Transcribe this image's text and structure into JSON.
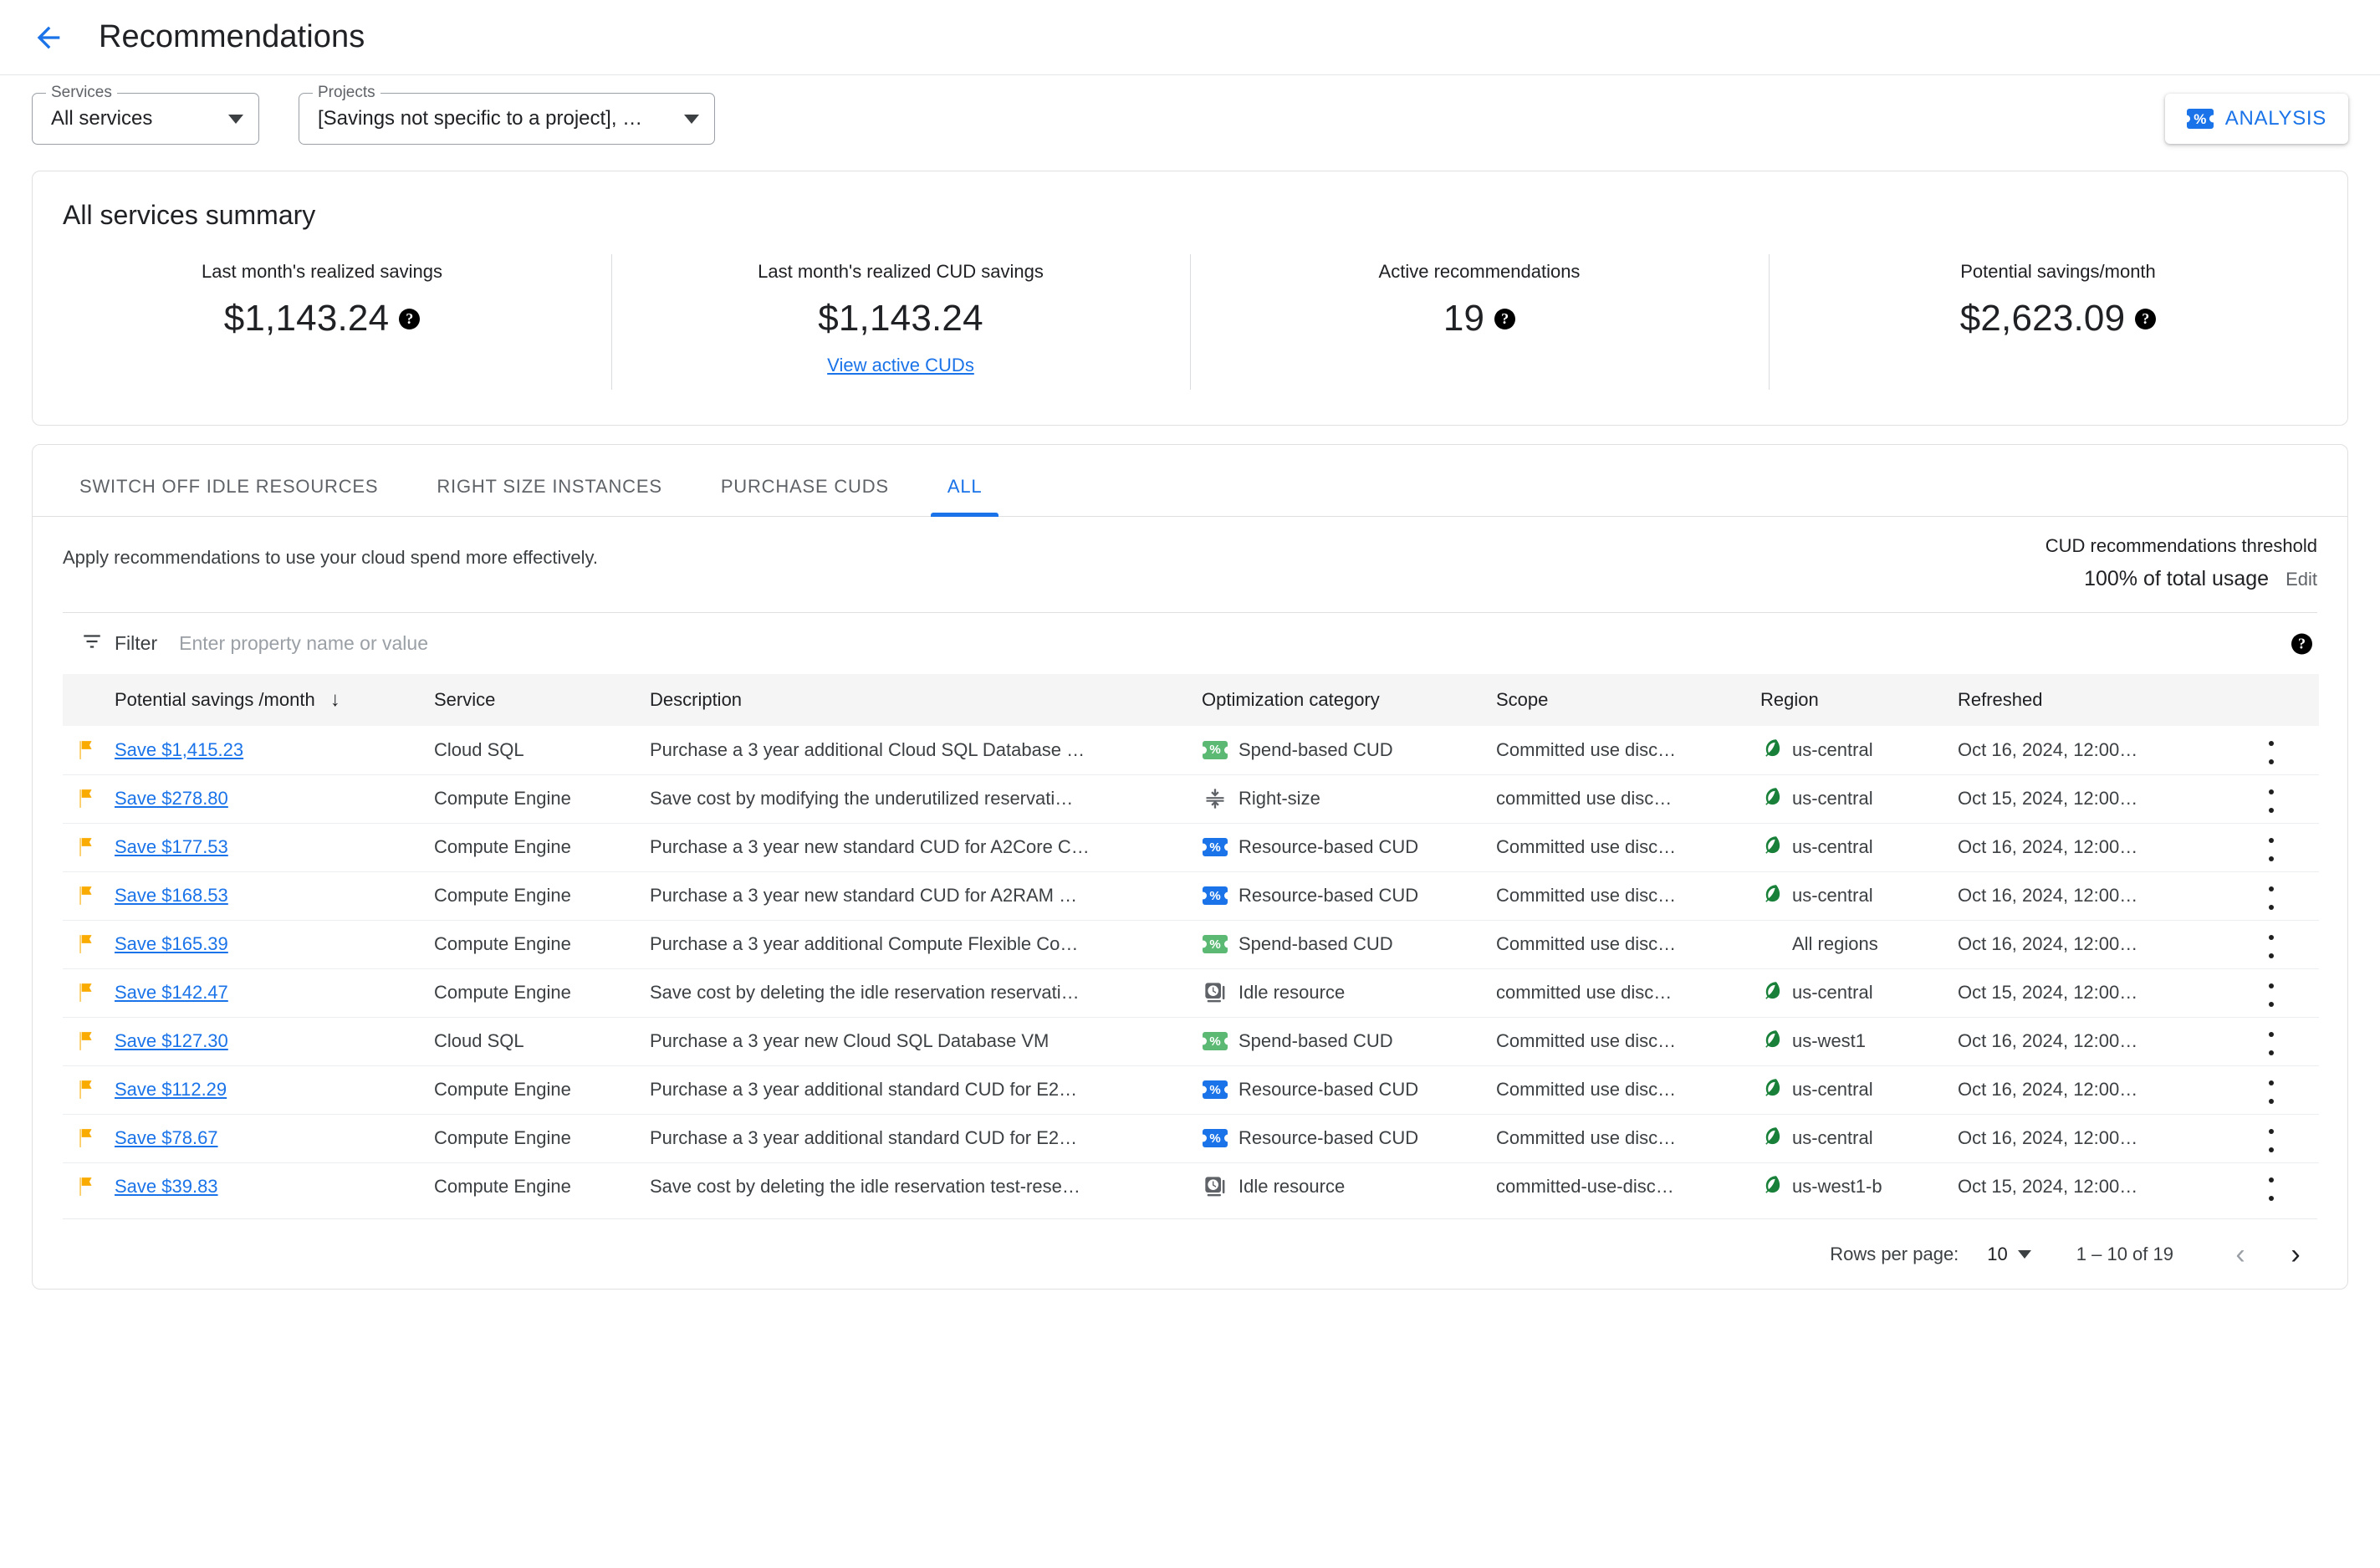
{
  "appbar": {
    "back_icon": "arrow-left-icon",
    "title": "Recommendations"
  },
  "filters": {
    "services": {
      "legend": "Services",
      "value": "All services"
    },
    "projects": {
      "legend": "Projects",
      "value": "[Savings not specific to a project], …"
    },
    "analysis_button": {
      "label": "ANALYSIS",
      "icon": "ticket-percent-icon",
      "color": "#1a73e8"
    }
  },
  "summary": {
    "title": "All services summary",
    "metrics": [
      {
        "label": "Last month's realized savings",
        "value": "$1,143.24",
        "help": true,
        "link": null
      },
      {
        "label": "Last month's realized CUD savings",
        "value": "$1,143.24",
        "help": false,
        "link": "View active CUDs"
      },
      {
        "label": "Active recommendations",
        "value": "19",
        "help": true,
        "link": null
      },
      {
        "label": "Potential savings/month",
        "value": "$2,623.09",
        "help": true,
        "link": null
      }
    ]
  },
  "tabs": [
    {
      "label": "SWITCH OFF IDLE RESOURCES",
      "active": false
    },
    {
      "label": "RIGHT SIZE INSTANCES",
      "active": false
    },
    {
      "label": "PURCHASE CUDS",
      "active": false
    },
    {
      "label": "ALL",
      "active": true
    }
  ],
  "subhead": {
    "description": "Apply recommendations to use your cloud spend more effectively.",
    "cud_threshold_title": "CUD recommendations threshold",
    "cud_threshold_value": "100% of total usage",
    "cud_edit_label": "Edit"
  },
  "filter_bar": {
    "label": "Filter",
    "placeholder": "Enter property name or value",
    "filter_icon": "filter-list-icon",
    "help_icon": "help-circle-icon"
  },
  "table": {
    "columns": [
      "",
      "Potential savings /month",
      "Service",
      "Description",
      "Optimization category",
      "Scope",
      "Region",
      "Refreshed",
      ""
    ],
    "sort_column": "Potential savings /month",
    "sort_direction": "desc",
    "rows": [
      {
        "flag": "flag-icon",
        "savings": "Save $1,415.23",
        "service": "Cloud SQL",
        "description": "Purchase a 3 year additional Cloud SQL Database …",
        "category": "Spend-based CUD",
        "category_icon": "ticket-percent-green-icon",
        "scope": "Committed use disc…",
        "region": "us-central",
        "region_icon": "leaf-icon",
        "refreshed": "Oct 16, 2024, 12:00…"
      },
      {
        "flag": "flag-icon",
        "savings": "Save $278.80",
        "service": "Compute Engine",
        "description": "Save cost by modifying the underutilized reservati…",
        "category": "Right-size",
        "category_icon": "compress-arrows-icon",
        "scope": "committed use disc…",
        "region": "us-central",
        "region_icon": "leaf-icon",
        "refreshed": "Oct 15, 2024, 12:00…"
      },
      {
        "flag": "flag-icon",
        "savings": "Save $177.53",
        "service": "Compute Engine",
        "description": "Purchase a 3 year new standard CUD for A2Core C…",
        "category": "Resource-based CUD",
        "category_icon": "ticket-percent-blue-icon",
        "scope": "Committed use disc…",
        "region": "us-central",
        "region_icon": "leaf-icon",
        "refreshed": "Oct 16, 2024, 12:00…"
      },
      {
        "flag": "flag-icon",
        "savings": "Save $168.53",
        "service": "Compute Engine",
        "description": "Purchase a 3 year new standard CUD for A2RAM …",
        "category": "Resource-based CUD",
        "category_icon": "ticket-percent-blue-icon",
        "scope": "Committed use disc…",
        "region": "us-central",
        "region_icon": "leaf-icon",
        "refreshed": "Oct 16, 2024, 12:00…"
      },
      {
        "flag": "flag-icon",
        "savings": "Save $165.39",
        "service": "Compute Engine",
        "description": "Purchase a 3 year additional Compute Flexible Co…",
        "category": "Spend-based CUD",
        "category_icon": "ticket-percent-green-icon",
        "scope": "Committed use disc…",
        "region": "All regions",
        "region_icon": null,
        "refreshed": "Oct 16, 2024, 12:00…"
      },
      {
        "flag": "flag-icon",
        "savings": "Save $142.47",
        "service": "Compute Engine",
        "description": "Save cost by deleting the idle reservation reservati…",
        "category": "Idle resource",
        "category_icon": "idle-clock-icon",
        "scope": "committed use disc…",
        "region": "us-central",
        "region_icon": "leaf-icon",
        "refreshed": "Oct 15, 2024, 12:00…"
      },
      {
        "flag": "flag-icon",
        "savings": "Save $127.30",
        "service": "Cloud SQL",
        "description": "Purchase a 3 year new Cloud SQL Database VM",
        "category": "Spend-based CUD",
        "category_icon": "ticket-percent-green-icon",
        "scope": "Committed use disc…",
        "region": "us-west1",
        "region_icon": "leaf-icon",
        "refreshed": "Oct 16, 2024, 12:00…"
      },
      {
        "flag": "flag-icon",
        "savings": "Save $112.29",
        "service": "Compute Engine",
        "description": "Purchase a 3 year additional standard CUD for E2…",
        "category": "Resource-based CUD",
        "category_icon": "ticket-percent-blue-icon",
        "scope": "Committed use disc…",
        "region": "us-central",
        "region_icon": "leaf-icon",
        "refreshed": "Oct 16, 2024, 12:00…"
      },
      {
        "flag": "flag-icon",
        "savings": "Save $78.67",
        "service": "Compute Engine",
        "description": "Purchase a 3 year additional standard CUD for E2…",
        "category": "Resource-based CUD",
        "category_icon": "ticket-percent-blue-icon",
        "scope": "Committed use disc…",
        "region": "us-central",
        "region_icon": "leaf-icon",
        "refreshed": "Oct 16, 2024, 12:00…"
      },
      {
        "flag": "flag-icon",
        "savings": "Save $39.83",
        "service": "Compute Engine",
        "description": "Save cost by deleting the idle reservation test-rese…",
        "category": "Idle resource",
        "category_icon": "idle-clock-icon",
        "scope": "committed-use-disc…",
        "region": "us-west1-b",
        "region_icon": "leaf-icon",
        "refreshed": "Oct 15, 2024, 12:00…"
      }
    ]
  },
  "pagination": {
    "rows_per_page_label": "Rows per page:",
    "rows_per_page_value": "10",
    "range_label": "1 – 10 of 19",
    "prev_icon": "chevron-left-icon",
    "next_icon": "chevron-right-icon"
  },
  "colors": {
    "accent": "#1a73e8",
    "flag": "#f9ab00",
    "leaf": "#188038",
    "green_badge": "#5bb974"
  }
}
